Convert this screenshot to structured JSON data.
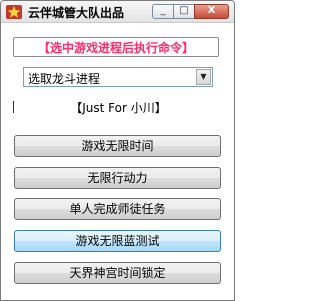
{
  "window": {
    "title": "云伴城管大队出品",
    "controls": {
      "minimize": "_",
      "maximize": "□",
      "close": "X"
    }
  },
  "header": {
    "text": "【选中游戏进程后执行命令】",
    "color": "#ff2d6a"
  },
  "process_select": {
    "value": "选取龙斗进程",
    "arrow": "▼"
  },
  "credit": {
    "text": "【Just For 小川】"
  },
  "buttons": [
    {
      "label": "游戏无限时间"
    },
    {
      "label": "无限行动力"
    },
    {
      "label": "单人完成师徒任务"
    },
    {
      "label": "游戏无限蓝测试"
    },
    {
      "label": "天界神宫时间锁定"
    }
  ]
}
